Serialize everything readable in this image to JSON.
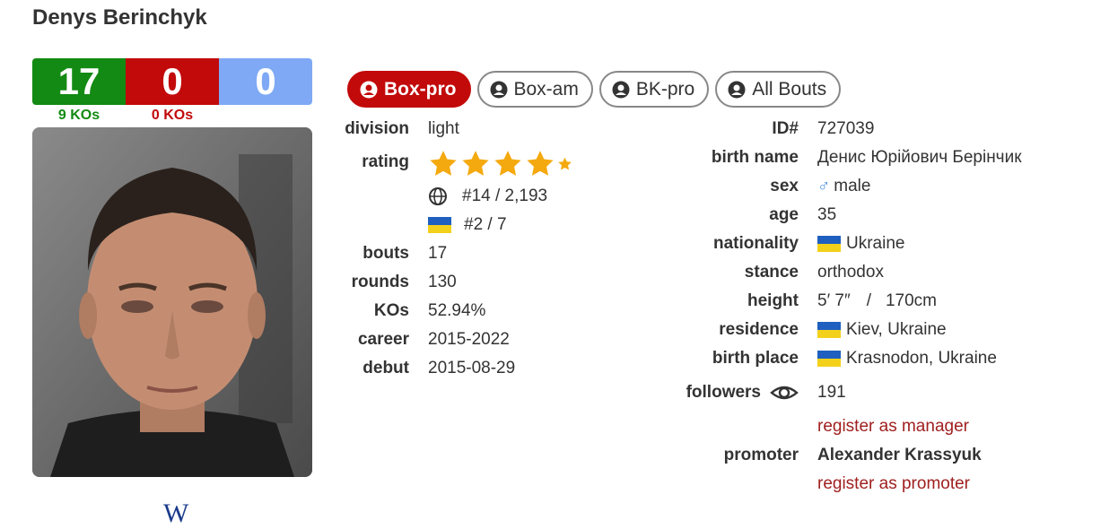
{
  "boxer": {
    "name": "Denys Berinchyk"
  },
  "record": {
    "wins": "17",
    "losses": "0",
    "draws": "0",
    "win_kos": "9 KOs",
    "loss_kos": "0 KOs"
  },
  "colors": {
    "win": "#138a13",
    "loss": "#c20a0a",
    "draw": "#7fa9f5",
    "active_tab": "#c20a0a",
    "link": "#a02020"
  },
  "tabs": [
    {
      "label": "Box-pro",
      "active": true,
      "icon": "user-circle-icon"
    },
    {
      "label": "Box-am",
      "active": false,
      "icon": "user-circle-icon"
    },
    {
      "label": "BK-pro",
      "active": false,
      "icon": "user-circle-icon"
    },
    {
      "label": "All Bouts",
      "active": false,
      "icon": "user-circle-icon"
    }
  ],
  "left_info": {
    "division_label": "division",
    "division": "light",
    "rating_label": "rating",
    "rating_stars": 4.5,
    "world_rank": "#14 / 2,193",
    "country_rank": "#2 / 7",
    "bouts_label": "bouts",
    "bouts": "17",
    "rounds_label": "rounds",
    "rounds": "130",
    "kos_label": "KOs",
    "kos": "52.94%",
    "career_label": "career",
    "career": "2015-2022",
    "debut_label": "debut",
    "debut": "2015-08-29"
  },
  "right_info": {
    "id_label": "ID#",
    "id": "727039",
    "birth_name_label": "birth name",
    "birth_name": "Денис Юрійович Берінчик",
    "sex_label": "sex",
    "sex": "male",
    "age_label": "age",
    "age": "35",
    "nationality_label": "nationality",
    "nationality": "Ukraine",
    "stance_label": "stance",
    "stance": "orthodox",
    "height_label": "height",
    "height_imperial": "5′ 7″",
    "height_sep": "/",
    "height_metric": "170cm",
    "residence_label": "residence",
    "residence": "Kiev, Ukraine",
    "birth_place_label": "birth place",
    "birth_place": "Krasnodon, Ukraine",
    "followers_label": "followers",
    "followers": "191",
    "register_manager": "register as manager",
    "promoter_label": "promoter",
    "promoter": "Alexander Krassyuk",
    "register_promoter": "register as promoter"
  },
  "wiki": {
    "glyph": "W"
  }
}
